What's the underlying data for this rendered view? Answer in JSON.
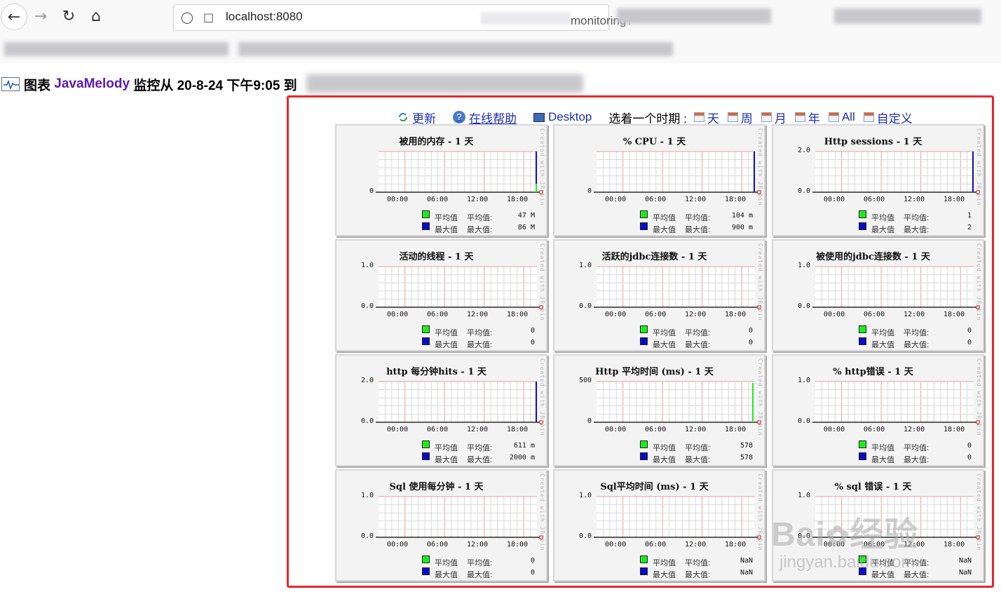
{
  "browser": {
    "url_start": "localhost:8080",
    "url_end": "monitoring?"
  },
  "page": {
    "header_prefix": "图表",
    "header_brand": "JavaMelody",
    "header_suffix": "监控从 20-8-24 下午9:05 到"
  },
  "links": {
    "refresh": "更新",
    "help": "在线帮助",
    "desktop": "Desktop",
    "period_label": "选着一个时期 :",
    "periods": [
      "天",
      "周",
      "月",
      "年",
      "All",
      "自定义"
    ]
  },
  "charts": {
    "watermark": "Created with JRobin",
    "x_ticks": [
      "00:00",
      "06:00",
      "12:00",
      "18:00"
    ],
    "legend_avg": "平均值",
    "legend_max": "最大值",
    "label_avg": "平均值:",
    "label_max": "最大值:",
    "colors": {
      "avg": "#1aee1a",
      "max": "#0a0acc",
      "grid_major": "#e8a0a0",
      "grid_minor": "#d9d9d9"
    },
    "items": [
      {
        "title": "被用的内存 - 1 天",
        "y_ticks": [
          "0"
        ],
        "avg": "47 M",
        "max": "86 M",
        "spike": "both"
      },
      {
        "title": "% CPU - 1 天",
        "y_ticks": [
          "0"
        ],
        "avg": "104 m",
        "max": "900 m",
        "spike": "blue"
      },
      {
        "title": "Http sessions - 1 天",
        "y_ticks": [
          "2.0",
          "0.0"
        ],
        "avg": "1",
        "max": "2",
        "spike": "blue"
      },
      {
        "title": "活动的线程 - 1 天",
        "y_ticks": [
          "1.0",
          "0.0"
        ],
        "avg": "0",
        "max": "0",
        "spike": "none"
      },
      {
        "title": "活跃的jdbc连接数 - 1 天",
        "y_ticks": [
          "1.0",
          "0.0"
        ],
        "avg": "0",
        "max": "0",
        "spike": "none"
      },
      {
        "title": "被使用的jdbc连接数 - 1 天",
        "y_ticks": [
          "1.0",
          "0.0"
        ],
        "avg": "0",
        "max": "0",
        "spike": "none"
      },
      {
        "title": "http 每分钟hits - 1 天",
        "y_ticks": [
          "2.0",
          "0.0"
        ],
        "avg": "611 m",
        "max": "2000 m",
        "spike": "blue"
      },
      {
        "title": "Http 平均时间 (ms) - 1 天",
        "y_ticks": [
          "500",
          "0"
        ],
        "avg": "578",
        "max": "578",
        "spike": "green"
      },
      {
        "title": "% http错误 - 1 天",
        "y_ticks": [
          "1.0",
          "0.0"
        ],
        "avg": "0",
        "max": "0",
        "spike": "none"
      },
      {
        "title": "Sql 使用每分钟 - 1 天",
        "y_ticks": [
          "1.0",
          "0.0"
        ],
        "avg": "0",
        "max": "0",
        "spike": "none"
      },
      {
        "title": "Sql平均时间 (ms) - 1 天",
        "y_ticks": [
          "1.0",
          "0.0"
        ],
        "avg": "NaN",
        "max": "NaN",
        "spike": "none"
      },
      {
        "title": "% sql 错误 - 1 天",
        "y_ticks": [
          "1.0",
          "0.0"
        ],
        "avg": "NaN",
        "max": "NaN",
        "spike": "none"
      }
    ]
  },
  "watermark": {
    "brand": "Bai",
    "brand_cn": "经验",
    "site": "jingyan.baidu.com"
  }
}
